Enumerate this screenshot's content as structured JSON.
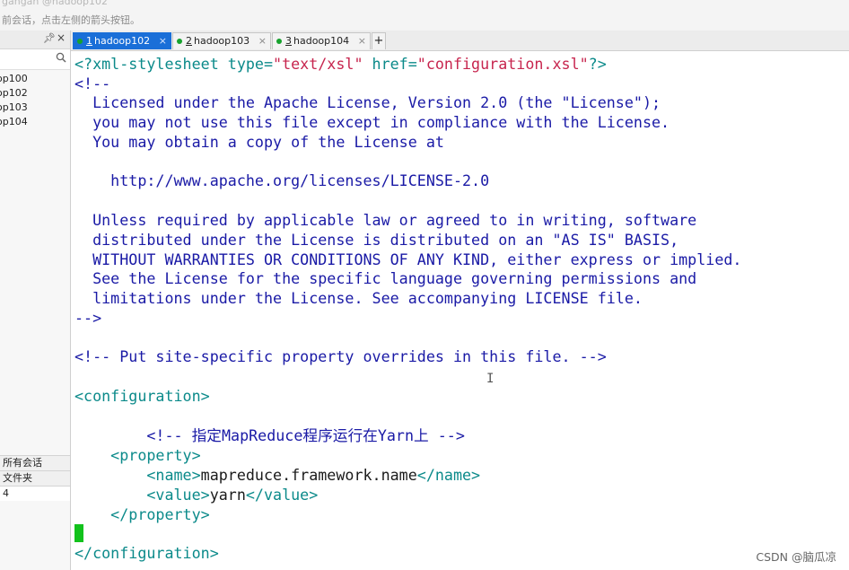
{
  "topbar": {
    "ghost_text": "gangan        @hadoop102",
    "tip": "前会话，点击左侧的箭头按钮。"
  },
  "sidebar": {
    "sessions": [
      "op100",
      "op102",
      "op103",
      "op104"
    ],
    "bottom": {
      "all_sessions": "所有会话",
      "folder": "文件夹",
      "value": "4"
    }
  },
  "tabs": [
    {
      "num": "1",
      "label": "hadoop102",
      "active": true
    },
    {
      "num": "2",
      "label": "hadoop103",
      "active": false
    },
    {
      "num": "3",
      "label": "hadoop104",
      "active": false
    }
  ],
  "tab_add": "+",
  "tab_close": "×",
  "editor": {
    "l1_a": "<?xml-stylesheet ",
    "l1_b": "type=",
    "l1_c": "\"text/xsl\"",
    "l1_d": " href=",
    "l1_e": "\"configuration.xsl\"",
    "l1_f": "?>",
    "l2": "<!--",
    "l3": "  Licensed under the Apache License, Version 2.0 (the \"License\");",
    "l4": "  you may not use this file except in compliance with the License.",
    "l5": "  You may obtain a copy of the License at",
    "l6": "    http://www.apache.org/licenses/LICENSE-2.0",
    "l7": "  Unless required by applicable law or agreed to in writing, software",
    "l8": "  distributed under the License is distributed on an \"AS IS\" BASIS,",
    "l9": "  WITHOUT WARRANTIES OR CONDITIONS OF ANY KIND, either express or implied.",
    "l10": "  See the License for the specific language governing permissions and",
    "l11": "  limitations under the License. See accompanying LICENSE file.",
    "l12": "-->",
    "l13": "<!-- Put site-specific property overrides in this file. -->",
    "l14": "<configuration>",
    "l15": "        <!-- 指定MapReduce程序运行在Yarn上 -->",
    "l16": "    <property>",
    "l17_open": "        <name>",
    "l17_val": "mapreduce.framework.name",
    "l17_close": "</name>",
    "l18_open": "        <value>",
    "l18_val": "yarn",
    "l18_close": "</value>",
    "l19": "    </property>",
    "l20": "</configuration>"
  },
  "ibeam": "I",
  "watermark": "CSDN @脑瓜凉",
  "colors": {
    "tag": "#0b8a8a",
    "attr_value": "#c7254e",
    "comment": "#1a1aa6",
    "active_tab": "#1a6fd8",
    "cursor": "#12c21c"
  }
}
